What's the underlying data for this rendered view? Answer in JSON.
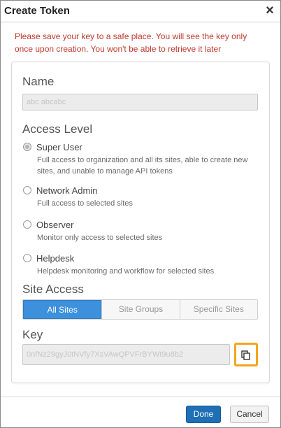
{
  "dialog": {
    "title": "Create Token",
    "close_label": "×"
  },
  "warning": "Please save your key to a safe place. You will see the key only once upon creation. You won't be able to retrieve it later",
  "form": {
    "name_label": "Name",
    "name_value": "abc abcabc",
    "access_level_label": "Access Level",
    "access_options": [
      {
        "label": "Super User",
        "description": "Full access to organization and all its sites, able to create new sites, and unable to manage API tokens",
        "selected": true
      },
      {
        "label": "Network Admin",
        "description": "Full access to selected sites",
        "selected": false
      },
      {
        "label": "Observer",
        "description": "Monitor only access to selected sites",
        "selected": false
      },
      {
        "label": "Helpdesk",
        "description": "Helpdesk monitoring and workflow for selected sites",
        "selected": false
      }
    ],
    "site_access_label": "Site Access",
    "site_access_tabs": [
      {
        "label": "All Sites",
        "active": true
      },
      {
        "label": "Site Groups",
        "active": false
      },
      {
        "label": "Specific Sites",
        "active": false
      }
    ],
    "key_label": "Key",
    "key_value": "0nfNz29gyJ0tNVfy7XsVAwQPVFrBYWt9u8b2"
  },
  "footer": {
    "done_label": "Done",
    "cancel_label": "Cancel"
  },
  "colors": {
    "accent": "#3c90dc",
    "primary_button": "#1f6fb5",
    "warning_text": "#c0392b",
    "copy_highlight": "#f4a51c"
  },
  "icons": {
    "close": "close-icon",
    "copy": "copy-icon"
  }
}
